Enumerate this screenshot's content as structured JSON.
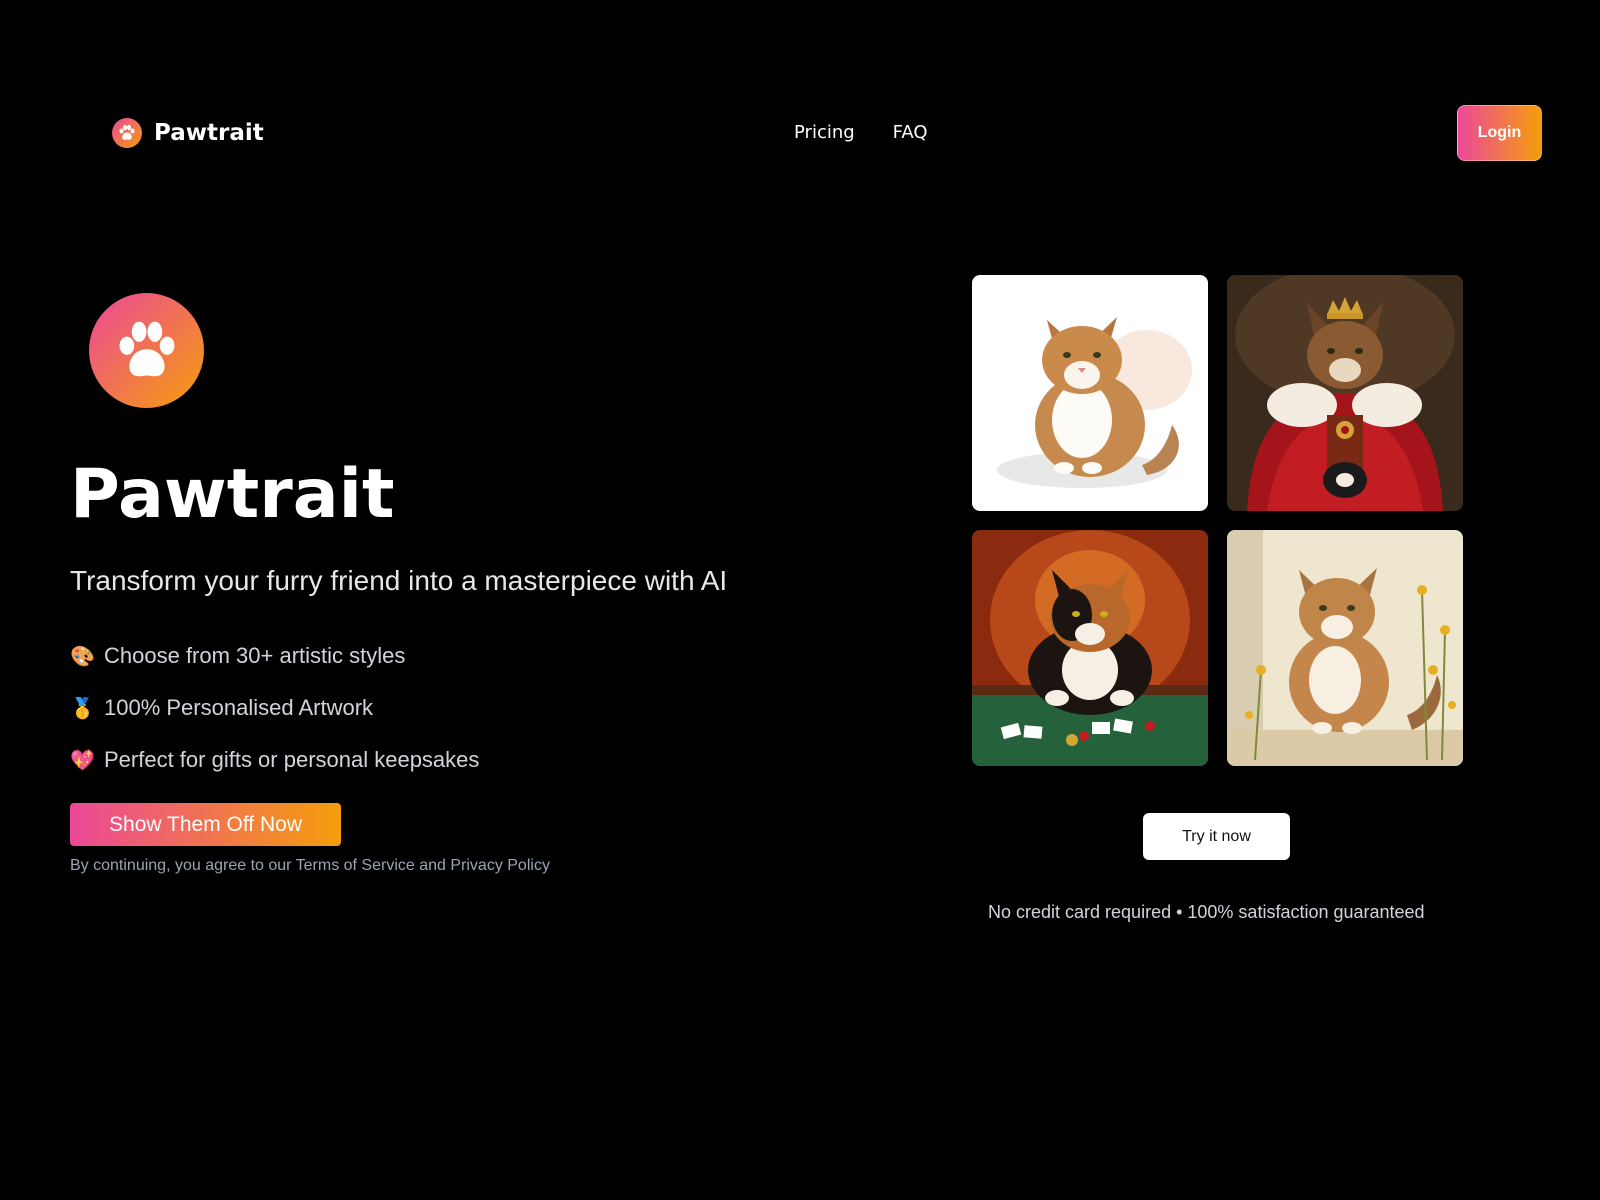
{
  "header": {
    "brand_name": "Pawtrait",
    "nav": [
      {
        "label": "Pricing"
      },
      {
        "label": "FAQ"
      }
    ],
    "login_label": "Login"
  },
  "hero": {
    "title": "Pawtrait",
    "subtitle": "Transform your furry friend into a masterpiece with AI",
    "features": [
      {
        "icon": "palette-icon",
        "glyph": "🎨",
        "text": "Choose from 30+ artistic styles"
      },
      {
        "icon": "medal-icon",
        "glyph": "🥇",
        "text": "100% Personalised Artwork"
      },
      {
        "icon": "heart-icon",
        "glyph": "💖",
        "text": "Perfect for gifts or personal keepsakes"
      }
    ],
    "cta_label": "Show Them Off Now",
    "terms": "By continuing, you agree to our Terms of Service and Privacy Policy"
  },
  "gallery": {
    "images": [
      {
        "name": "watercolor-cat-image",
        "style": "watercolor"
      },
      {
        "name": "royal-cat-image",
        "style": "royal portrait"
      },
      {
        "name": "poker-cat-image",
        "style": "oil painting"
      },
      {
        "name": "flower-cat-image",
        "style": "illustration"
      }
    ],
    "try_label": "Try it now",
    "guarantee": "No credit card required • 100% satisfaction guaranteed"
  },
  "colors": {
    "background": "#000000",
    "gradient_start": "#ec4899",
    "gradient_end": "#f59e0b",
    "muted_text": "#9ca3af"
  }
}
